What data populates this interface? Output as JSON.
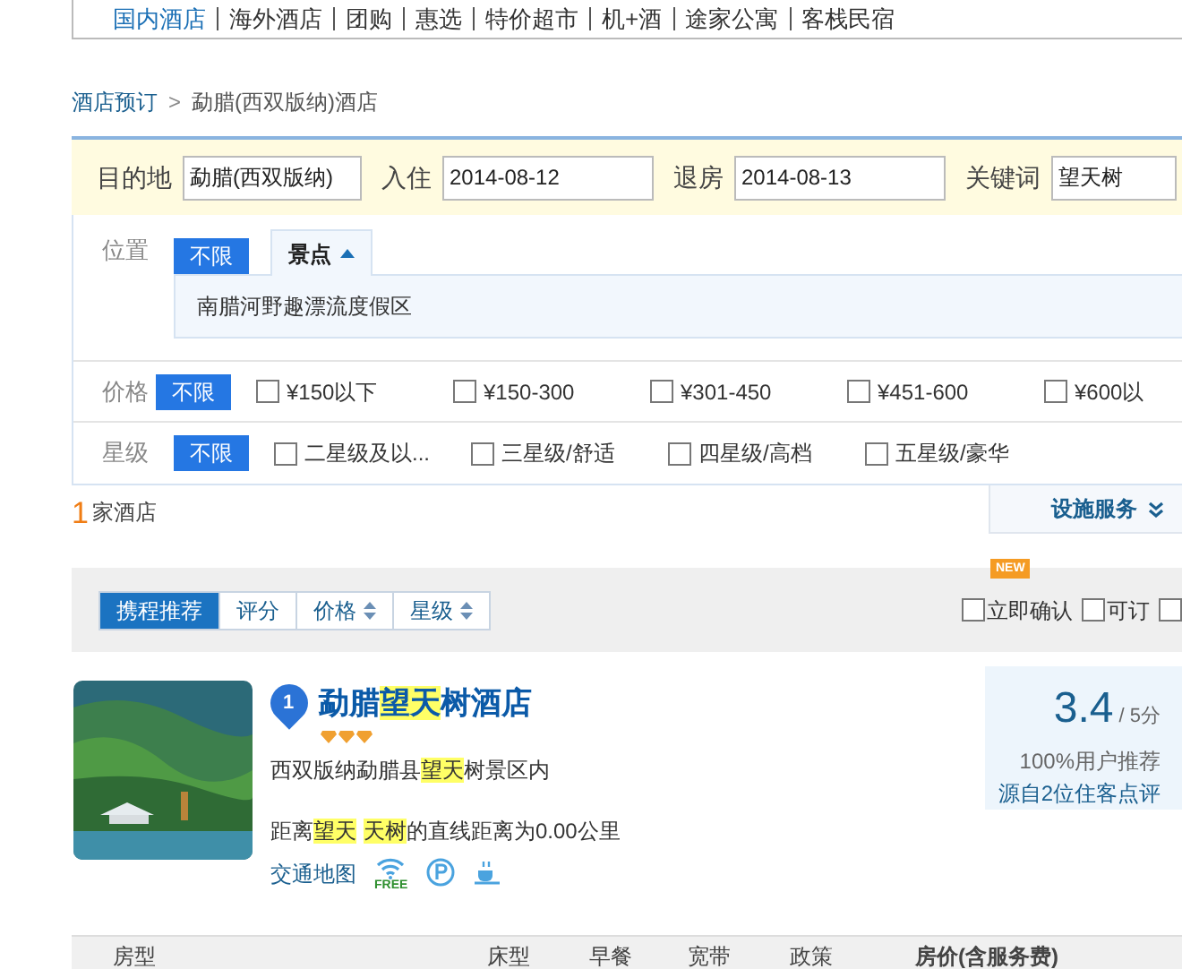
{
  "top_nav": [
    {
      "label": "国内酒店",
      "selected": true
    },
    {
      "label": "海外酒店",
      "selected": false
    },
    {
      "label": "团购",
      "selected": false
    },
    {
      "label": "惠选",
      "selected": false
    },
    {
      "label": "特价超市",
      "selected": false
    },
    {
      "label": "机+酒",
      "selected": false
    },
    {
      "label": "途家公寓",
      "selected": false
    },
    {
      "label": "客栈民宿",
      "selected": false
    }
  ],
  "breadcrumb": {
    "items": [
      "酒店预订",
      "勐腊(西双版纳)酒店"
    ],
    "separator": ">"
  },
  "search": [
    {
      "label": "目的地",
      "value": "勐腊(西双版纳)"
    },
    {
      "label": "入住",
      "value": "2014-08-12"
    },
    {
      "label": "退房",
      "value": "2014-08-13"
    },
    {
      "label": "关键词",
      "value": "望天树"
    }
  ],
  "filters": {
    "location": {
      "label": "位置",
      "any": "不限",
      "tab": "景点",
      "expanded": true,
      "items": [
        "南腊河野趣漂流度假区"
      ]
    },
    "price": {
      "label": "价格",
      "any": "不限",
      "options": [
        {
          "label": "¥150以下",
          "checked": false
        },
        {
          "label": "¥150-300",
          "checked": false
        },
        {
          "label": "¥301-450",
          "checked": false
        },
        {
          "label": "¥451-600",
          "checked": false
        },
        {
          "label": "¥600以",
          "checked": false
        }
      ]
    },
    "star": {
      "label": "星级",
      "any": "不限",
      "options": [
        {
          "label": "二星级及以...",
          "checked": false
        },
        {
          "label": "三星级/舒适",
          "checked": false
        },
        {
          "label": "四星级/高档",
          "checked": false
        },
        {
          "label": "五星级/豪华",
          "checked": false
        }
      ]
    }
  },
  "result_count": {
    "number": "1",
    "text": "家酒店"
  },
  "facilities_tab": "设施服务",
  "sort_tabs": [
    {
      "label": "携程推荐",
      "selected": true,
      "sortable": false
    },
    {
      "label": "评分",
      "selected": false,
      "sortable": false
    },
    {
      "label": "价格",
      "selected": false,
      "sortable": true
    },
    {
      "label": "星级",
      "selected": false,
      "sortable": true
    }
  ],
  "quick_filters": [
    {
      "label": "立即确认",
      "checked": false,
      "badge": "NEW"
    },
    {
      "label": "可订",
      "checked": false
    },
    {
      "checked": false
    }
  ],
  "hotel": {
    "rank": "1",
    "name": [
      {
        "text": "勐腊",
        "highlight": false
      },
      {
        "text": "望天",
        "highlight": true
      },
      {
        "text": "树酒店",
        "highlight": false
      }
    ],
    "stars": 3,
    "address": [
      {
        "text": "西双版纳勐腊县",
        "highlight": false
      },
      {
        "text": "望天",
        "highlight": true
      },
      {
        "text": "树景区内",
        "highlight": false
      }
    ],
    "distance": [
      {
        "text": "距离",
        "highlight": false
      },
      {
        "text": "望天",
        "highlight": true
      },
      {
        "text": "天树",
        "highlight": true
      },
      {
        "text": "的直线距离为0.00公里",
        "highlight": false
      }
    ],
    "map_link": "交通地图",
    "wifi_label": "FREE",
    "score": "3.4",
    "score_max": "/ 5分",
    "recommend": "100%用户推荐",
    "reviews": "源自2位住客点评"
  },
  "room_table": {
    "columns": [
      "房型",
      "床型",
      "早餐",
      "宽带",
      "政策",
      "房价(含服务费)"
    ]
  }
}
